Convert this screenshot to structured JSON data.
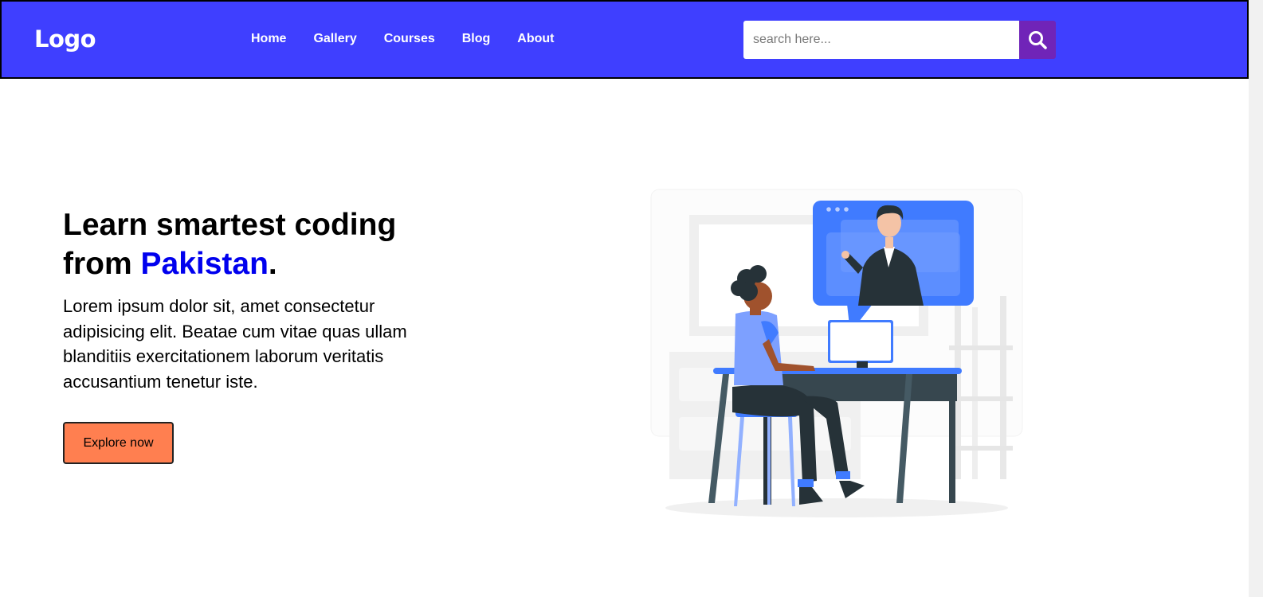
{
  "header": {
    "logo": "Logo",
    "nav": [
      "Home",
      "Gallery",
      "Courses",
      "Blog",
      "About"
    ],
    "search": {
      "placeholder": "search here...",
      "value": ""
    },
    "colors": {
      "navbar": "#3f3fff",
      "search_button": "#7024b8"
    }
  },
  "hero": {
    "title_line1": "Learn smartest coding",
    "title_from": "from ",
    "title_accent": "Pakistan",
    "title_period": ".",
    "paragraph": "Lorem ipsum dolor sit, amet consectetur adipisicing elit. Beatae cum vitae quas ullam blanditiis exercitationem laborum veritatis accusantium tenetur iste.",
    "cta_label": "Explore now",
    "colors": {
      "accent": "#0000ee",
      "cta": "#ff7f50"
    }
  },
  "icons": {
    "search": "search-icon"
  }
}
